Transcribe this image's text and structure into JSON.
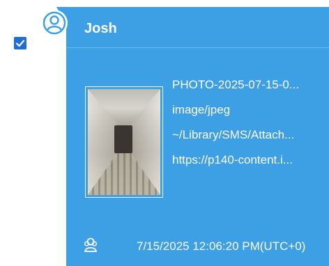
{
  "message": {
    "selected": true,
    "sender": "Josh",
    "attachment": {
      "filename": "PHOTO-2025-07-15-0...",
      "mime_type": "image/jpeg",
      "path": "~/Library/SMS/Attach...",
      "url": "https://p140-content.i..."
    },
    "timestamp": "7/15/2025 12:06:20 PM(UTC+0)"
  },
  "colors": {
    "bubble": "#3d9fe4",
    "checkbox": "#1f6fd0",
    "text": "#ffffff"
  },
  "icons": {
    "checkbox": "checkmark-icon",
    "avatar": "user-avatar-icon",
    "source": "contact-group-icon"
  }
}
